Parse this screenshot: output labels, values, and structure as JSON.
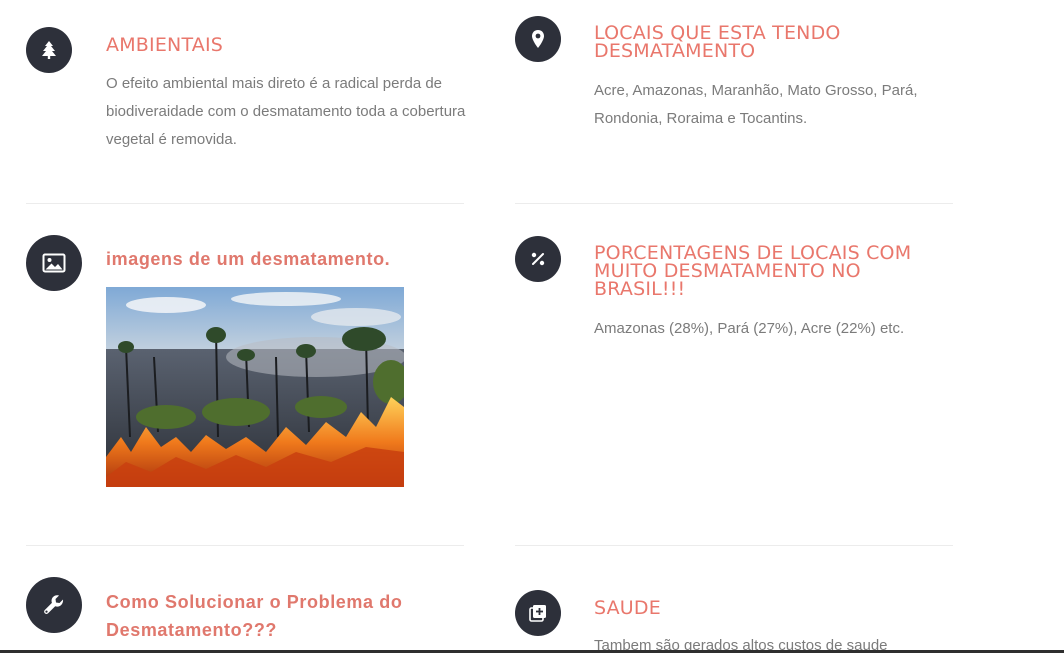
{
  "features": {
    "ambientais": {
      "title": "AMBIENTAIS",
      "text": "O efeito ambiental mais direto é a radical perda de biodiveraidade com o desmatamento toda a cobertura vegetal é removida.",
      "icon": "tree-icon"
    },
    "locais": {
      "title": "LOCAIS QUE ESTA TENDO DESMATAMENTO",
      "text": "Acre, Amazonas, Maranhão, Mato Grosso, Pará, Rondonia, Roraima e Tocantins.",
      "icon": "map-pin-icon"
    },
    "imagens": {
      "title": "imagens de um desmatamento.",
      "icon": "image-icon",
      "image_alt": "Floresta queimando - fogo e fumaça"
    },
    "porcentagens": {
      "title": "PORCENTAGENS DE LOCAIS COM MUITO DESMATAMENTO NO BRASIL!!!",
      "text": "Amazonas (28%), Pará (27%), Acre (22%) etc.",
      "icon": "percent-icon"
    },
    "solucionar": {
      "title": "Como Solucionar o Problema do Desmatamento???",
      "icon": "wrench-icon"
    },
    "saude": {
      "title": "SAUDE",
      "text": "Tambem são gerados altos custos de saude",
      "icon": "medical-plus-icon"
    }
  },
  "colors": {
    "accent": "#e9776c",
    "icon_bg": "#2d303a",
    "text": "#7b7b7b",
    "divider": "#ececec"
  }
}
